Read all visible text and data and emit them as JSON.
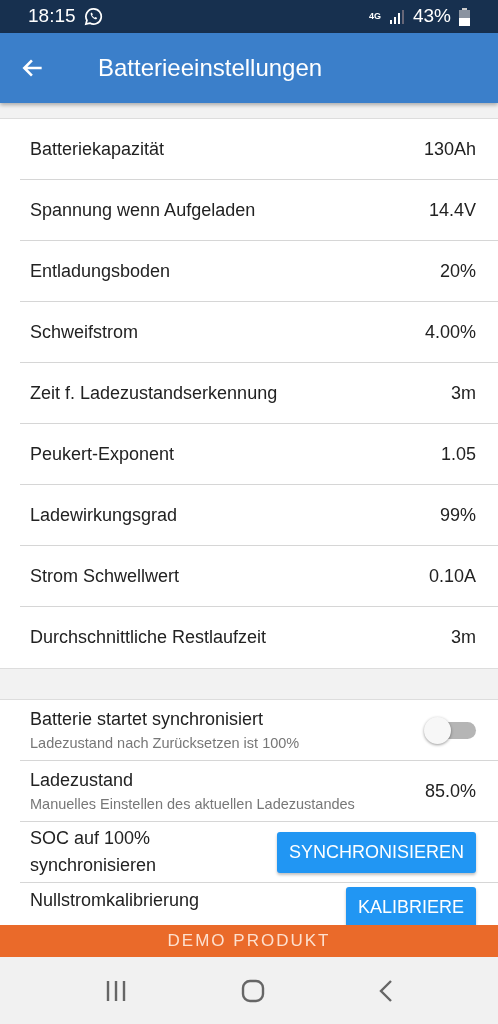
{
  "status_bar": {
    "time": "18:15",
    "network": "4G",
    "battery": "43%"
  },
  "app_bar": {
    "title": "Batterieeinstellungen"
  },
  "settings": [
    {
      "label": "Batteriekapazität",
      "value": "130Ah"
    },
    {
      "label": "Spannung wenn Aufgeladen",
      "value": "14.4V"
    },
    {
      "label": "Entladungsboden",
      "value": "20%"
    },
    {
      "label": "Schweifstrom",
      "value": "4.00%"
    },
    {
      "label": "Zeit f. Ladezustandserkennung",
      "value": "3m"
    },
    {
      "label": "Peukert-Exponent",
      "value": "1.05"
    },
    {
      "label": "Ladewirkungsgrad",
      "value": "99%"
    },
    {
      "label": "Strom Schwellwert",
      "value": "0.10A"
    },
    {
      "label": "Durchschnittliche Restlaufzeit",
      "value": "3m"
    }
  ],
  "sync_settings": [
    {
      "kind": "toggle",
      "label": "Batterie startet synchronisiert",
      "subtitle": "Ladezustand nach Zurücksetzen ist 100%",
      "on": false
    },
    {
      "kind": "value",
      "label": "Ladezustand",
      "subtitle": "Manuelles Einstellen des aktuellen Ladezustandes",
      "value": "85.0%"
    },
    {
      "kind": "button",
      "label": "SOC auf 100% synchronisieren",
      "button": "SYNCHRONISIEREN"
    },
    {
      "kind": "button",
      "label": "Nullstromkalibrierung",
      "button": "KALIBRIERE"
    }
  ],
  "banner": "DEMO PRODUKT"
}
